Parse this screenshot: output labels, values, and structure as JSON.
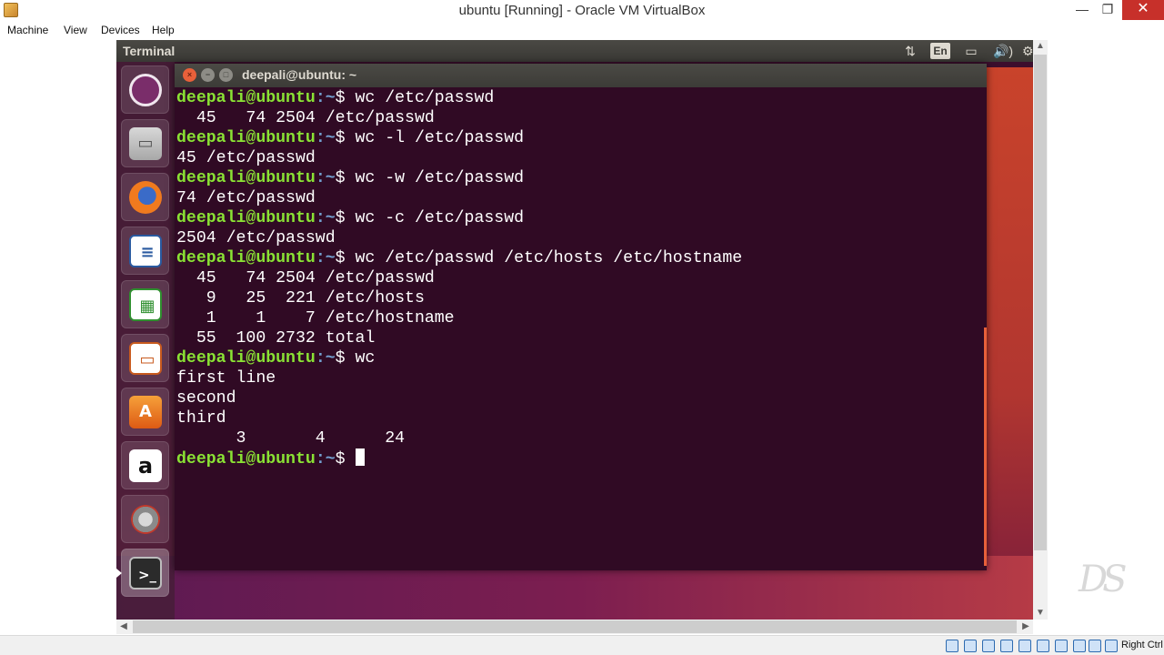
{
  "host_window": {
    "title": "ubuntu [Running] - Oracle VM VirtualBox",
    "min_glyph": "—",
    "max_glyph": "❐",
    "close_glyph": "✕"
  },
  "menu": [
    "Machine",
    "View",
    "Devices",
    "Help"
  ],
  "ubuntu_panel": {
    "app_label": "Terminal",
    "tray": {
      "keyboard": "En",
      "network_glyph": "⇅",
      "volume_glyph": "🔊)",
      "battery_glyph": "▭"
    }
  },
  "launcher": [
    {
      "name": "ubuntu-dash-icon",
      "glyph": ""
    },
    {
      "name": "files-icon",
      "glyph": ""
    },
    {
      "name": "firefox-icon",
      "glyph": ""
    },
    {
      "name": "libreoffice-writer-icon",
      "glyph": "≡"
    },
    {
      "name": "libreoffice-calc-icon",
      "glyph": "▦"
    },
    {
      "name": "libreoffice-impress-icon",
      "glyph": "▭"
    },
    {
      "name": "software-center-icon",
      "glyph": "A"
    },
    {
      "name": "amazon-icon",
      "glyph": "a"
    },
    {
      "name": "system-settings-icon",
      "glyph": ""
    },
    {
      "name": "terminal-icon",
      "glyph": ">_"
    }
  ],
  "terminal": {
    "window_title": "deepali@ubuntu: ~",
    "lines": [
      {
        "type": "cmd",
        "user": "deepali@ubuntu",
        "path": ":~",
        "cmd": "$ wc /etc/passwd"
      },
      {
        "type": "out",
        "text": "  45   74 2504 /etc/passwd"
      },
      {
        "type": "cmd",
        "user": "deepali@ubuntu",
        "path": ":~",
        "cmd": "$ wc -l /etc/passwd"
      },
      {
        "type": "out",
        "text": "45 /etc/passwd"
      },
      {
        "type": "cmd",
        "user": "deepali@ubuntu",
        "path": ":~",
        "cmd": "$ wc -w /etc/passwd"
      },
      {
        "type": "out",
        "text": "74 /etc/passwd"
      },
      {
        "type": "cmd",
        "user": "deepali@ubuntu",
        "path": ":~",
        "cmd": "$ wc -c /etc/passwd"
      },
      {
        "type": "out",
        "text": "2504 /etc/passwd"
      },
      {
        "type": "cmd",
        "user": "deepali@ubuntu",
        "path": ":~",
        "cmd": "$ wc /etc/passwd /etc/hosts /etc/hostname"
      },
      {
        "type": "out",
        "text": "  45   74 2504 /etc/passwd"
      },
      {
        "type": "out",
        "text": "   9   25  221 /etc/hosts"
      },
      {
        "type": "out",
        "text": "   1    1    7 /etc/hostname"
      },
      {
        "type": "out",
        "text": "  55  100 2732 total"
      },
      {
        "type": "cmd",
        "user": "deepali@ubuntu",
        "path": ":~",
        "cmd": "$ wc"
      },
      {
        "type": "out",
        "text": "first line"
      },
      {
        "type": "out",
        "text": "second"
      },
      {
        "type": "out",
        "text": "third"
      },
      {
        "type": "out",
        "text": "      3       4      24"
      },
      {
        "type": "prompt",
        "user": "deepali@ubuntu",
        "path": ":~",
        "cmd": "$ "
      }
    ]
  },
  "statusbar": {
    "host_key": "Right Ctrl"
  },
  "watermark": "DS"
}
